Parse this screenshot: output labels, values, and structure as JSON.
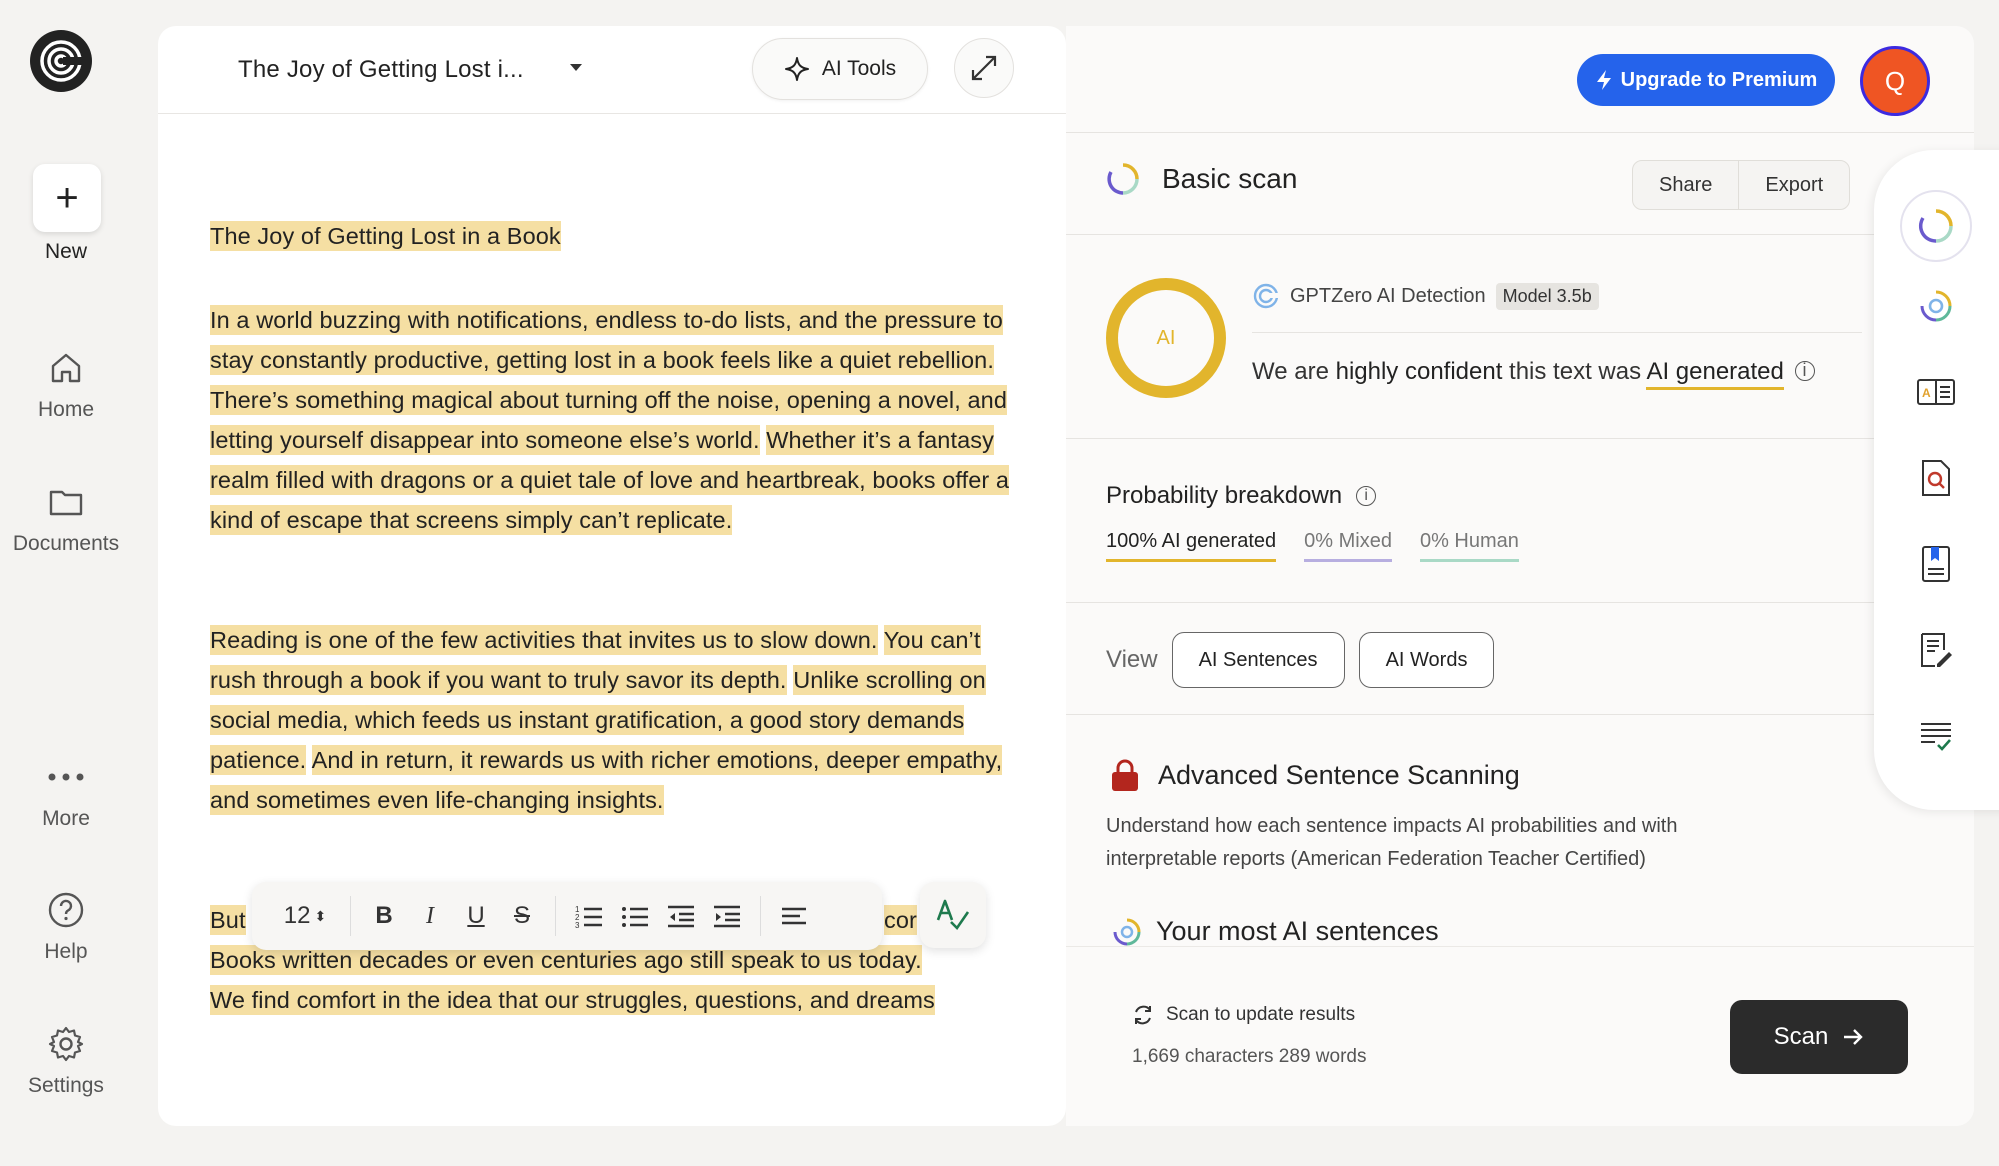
{
  "sidebar": {
    "new_label": "New",
    "items": [
      {
        "label": "Home",
        "icon": "home-icon"
      },
      {
        "label": "Documents",
        "icon": "folder-icon"
      },
      {
        "label": "More",
        "icon": "more-icon"
      },
      {
        "label": "Help",
        "icon": "help-icon"
      },
      {
        "label": "Settings",
        "icon": "gear-icon"
      }
    ]
  },
  "editor": {
    "doc_title": "The Joy of Getting Lost i...",
    "ai_tools_label": "AI Tools",
    "title_line": "The Joy of Getting Lost in a Book",
    "p1": [
      "In a world buzzing with notifications, endless to-do lists, and the pressure to stay constantly productive, getting lost in a book feels like a quiet rebellion.",
      "There’s something magical about turning off the noise, opening a novel, and letting yourself disappear into someone else’s world.",
      "Whether it’s a fantasy realm filled with dragons or a quiet tale of love and heartbreak, books offer a kind of escape that screens simply can’t replicate."
    ],
    "p2": [
      "Reading is one of the few activities that invites us to slow down.",
      "You can’t rush through a book if you want to truly savor its depth.",
      "Unlike scrolling on social media, which feeds us instant gratification, a good story demands patience.",
      "And in return, it rewards us with richer emotions, deeper empathy, and sometimes even life-changing insights."
    ],
    "p3_start": "But",
    "p3_fragment": "cor",
    "p3_dot": ".",
    "p3_line2": "Books written decades or even centuries ago still speak to us today.",
    "p3_line3": "We find comfort in the idea that our struggles, questions, and dreams",
    "toolbar": {
      "font_size": "12"
    }
  },
  "header": {
    "upgrade_label": "Upgrade to Premium",
    "avatar_initial": "Q"
  },
  "scan": {
    "title": "Basic scan",
    "share_label": "Share",
    "export_label": "Export",
    "circle_label": "AI",
    "detector_name": "GPTZero AI Detection",
    "model_badge": "Model 3.5b",
    "confidence_prefix": "We are ",
    "confidence_strong": "highly confident",
    "confidence_mid": " this text was ",
    "confidence_result": "AI generated",
    "breakdown_title": "Probability breakdown",
    "breakdown": [
      {
        "label": "100% AI generated",
        "color": "#e2b52c"
      },
      {
        "label": "0% Mixed",
        "color": "#b7aee0"
      },
      {
        "label": "0% Human",
        "color": "#a9d9c6"
      }
    ],
    "view_label": "View",
    "view_buttons": [
      "AI Sentences",
      "AI Words"
    ],
    "advanced_title": "Advanced Sentence Scanning",
    "advanced_desc": "Understand how each sentence impacts AI probabilities and with interpretable reports (American Federation Teacher Certified)",
    "most_ai_title": "Your most AI sentences",
    "update_text": "Scan to update results",
    "counts_text": "1,669 characters 289 words",
    "scan_button": "Scan"
  },
  "colors": {
    "highlight": "#f5dfa3",
    "ai_yellow": "#e2b52c",
    "premium_blue": "#2563eb",
    "avatar_orange": "#ef5523"
  }
}
